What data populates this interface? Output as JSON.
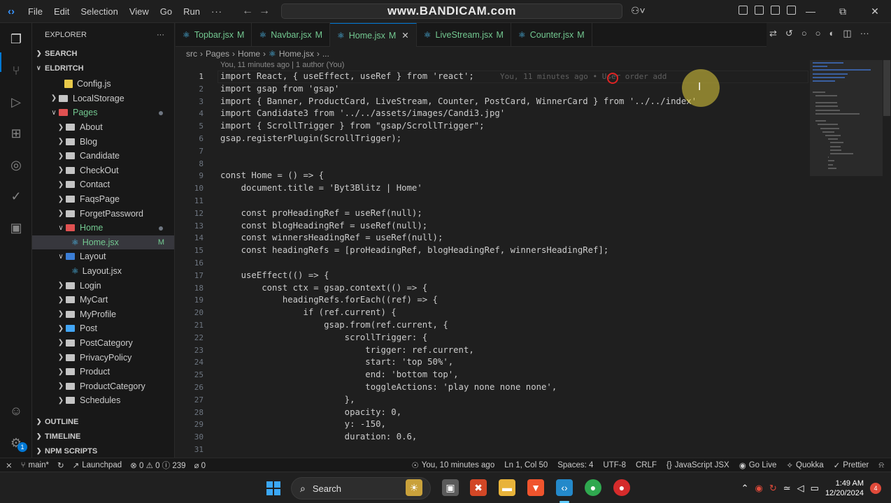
{
  "titlebar": {
    "menu": [
      "File",
      "Edit",
      "Selection",
      "View",
      "Go",
      "Run",
      "···"
    ],
    "command_center": "www.BANDICAM.com"
  },
  "explorer": {
    "title": "EXPLORER",
    "search_section": "SEARCH",
    "root_folder": "ELDRITCH",
    "items": [
      {
        "label": "Config.js",
        "badge": ""
      },
      {
        "label": "LocalStorage",
        "badge": ""
      },
      {
        "label": "Pages",
        "badge": ""
      },
      {
        "label": "About",
        "badge": ""
      },
      {
        "label": "Blog",
        "badge": ""
      },
      {
        "label": "Candidate",
        "badge": ""
      },
      {
        "label": "CheckOut",
        "badge": ""
      },
      {
        "label": "Contact",
        "badge": ""
      },
      {
        "label": "FaqsPage",
        "badge": ""
      },
      {
        "label": "ForgetPassword",
        "badge": ""
      },
      {
        "label": "Home",
        "badge": ""
      },
      {
        "label": "Home.jsx",
        "badge": "M"
      },
      {
        "label": "Layout",
        "badge": ""
      },
      {
        "label": "Layout.jsx",
        "badge": ""
      },
      {
        "label": "Login",
        "badge": ""
      },
      {
        "label": "MyCart",
        "badge": ""
      },
      {
        "label": "MyProfile",
        "badge": ""
      },
      {
        "label": "Post",
        "badge": ""
      },
      {
        "label": "PostCategory",
        "badge": ""
      },
      {
        "label": "PrivacyPolicy",
        "badge": ""
      },
      {
        "label": "Product",
        "badge": ""
      },
      {
        "label": "ProductCategory",
        "badge": ""
      },
      {
        "label": "Schedules",
        "badge": ""
      }
    ],
    "outline": "OUTLINE",
    "timeline": "TIMELINE",
    "npm_scripts": "NPM SCRIPTS"
  },
  "tabs": [
    {
      "name": "Topbar.jsx",
      "status": "M"
    },
    {
      "name": "Navbar.jsx",
      "status": "M"
    },
    {
      "name": "Home.jsx",
      "status": "M"
    },
    {
      "name": "LiveStream.jsx",
      "status": "M"
    },
    {
      "name": "Counter.jsx",
      "status": "M"
    }
  ],
  "breadcrumb": [
    "src",
    "Pages",
    "Home",
    "Home.jsx",
    "..."
  ],
  "blame_header": "You, 11 minutes ago | 1 author (You)",
  "inline_blame": "You, 11 minutes ago • User order add",
  "editor": {
    "line_numbers": [
      "1",
      "2",
      "3",
      "4",
      "5",
      "6",
      "7",
      "8",
      "9",
      "10",
      "11",
      "12",
      "13",
      "14",
      "15",
      "16",
      "17",
      "18",
      "19",
      "20",
      "21",
      "22",
      "23",
      "24",
      "25",
      "26",
      "27",
      "28",
      "29",
      "30",
      "31"
    ],
    "code": [
      "import React, { useEffect, useRef } from 'react';",
      "import gsap from 'gsap'",
      "import { Banner, ProductCard, LiveStream, Counter, PostCard, WinnerCard } from '../../index'",
      "import Candidate3 from '../../assets/images/Candi3.jpg'",
      "import { ScrollTrigger } from \"gsap/ScrollTrigger\";",
      "gsap.registerPlugin(ScrollTrigger);",
      "",
      "",
      "const Home = () => {",
      "    document.title = 'Byt3Blitz | Home'",
      "",
      "    const proHeadingRef = useRef(null);",
      "    const blogHeadingRef = useRef(null);",
      "    const winnersHeadingRef = useRef(null);",
      "    const headingRefs = [proHeadingRef, blogHeadingRef, winnersHeadingRef];",
      "",
      "    useEffect(() => {",
      "        const ctx = gsap.context(() => {",
      "            headingRefs.forEach((ref) => {",
      "                if (ref.current) {",
      "                    gsap.from(ref.current, {",
      "                        scrollTrigger: {",
      "                            trigger: ref.current,",
      "                            start: 'top 50%',",
      "                            end: 'bottom top',",
      "                            toggleActions: 'play none none none',",
      "                        },",
      "                        opacity: 0,",
      "                        y: -150,",
      "                        duration: 0.6,"
    ]
  },
  "statusbar": {
    "branch": "main*",
    "launchpad": "Launchpad",
    "problems": "⊗ 0 ⚠ 0 ⓘ 239",
    "ports": "⌀ 0",
    "blame": "You, 10 minutes ago",
    "position": "Ln 1, Col 50",
    "spaces": "Spaces: 4",
    "encoding": "UTF-8",
    "eol": "CRLF",
    "language": "JavaScript JSX",
    "golive": "Go Live",
    "quokka": "Quokka",
    "prettier": "Prettier"
  },
  "taskbar": {
    "search": "Search",
    "time": "1:49 AM",
    "date": "12/20/2024",
    "notifications": "4"
  },
  "colors": {
    "accent": "#0078d4",
    "modified": "#73c991",
    "react": "#4fc3f7"
  }
}
